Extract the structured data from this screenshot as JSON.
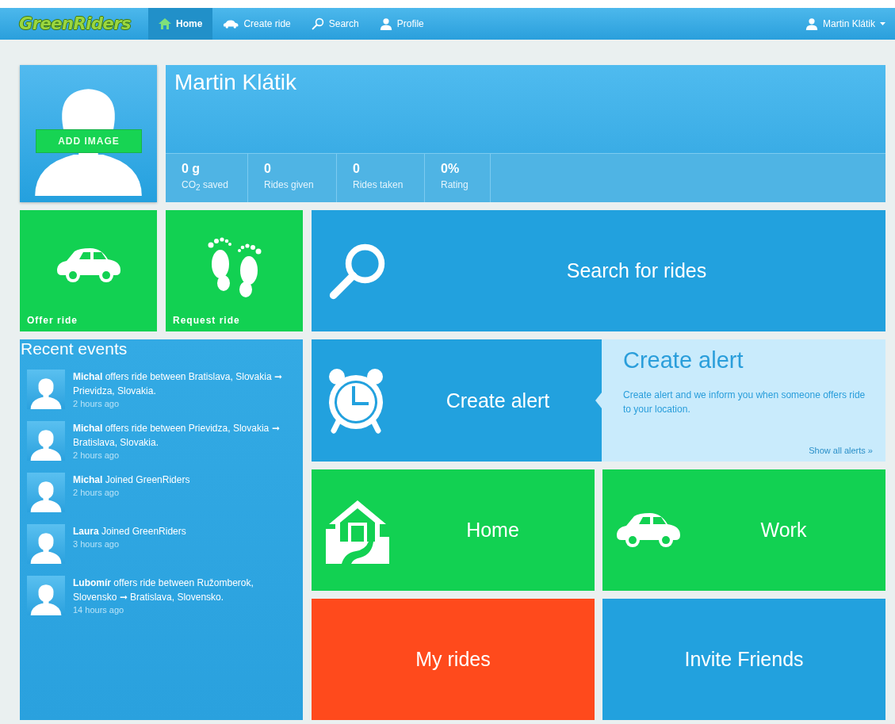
{
  "navbar": {
    "logo": "GreenRiders",
    "items": [
      {
        "label": "Home",
        "selected": true
      },
      {
        "label": "Create ride",
        "selected": false
      },
      {
        "label": "Search",
        "selected": false
      },
      {
        "label": "Profile",
        "selected": false
      }
    ],
    "user": "Martin Klátik"
  },
  "profile": {
    "add_image": "ADD IMAGE",
    "name": "Martin Klátik",
    "stats": [
      {
        "value": "0 g",
        "label": "CO$_{2}$ saved"
      },
      {
        "value": "0",
        "label": "Rides given"
      },
      {
        "value": "0",
        "label": "Rides taken"
      },
      {
        "value": "0%",
        "label": "Rating"
      }
    ]
  },
  "top_tiles": [
    {
      "label": "Offer ride",
      "color": "#12d152"
    },
    {
      "label": "Request ride",
      "color": "#12d152"
    },
    {
      "label": "Search for rides",
      "color": "#22a1de"
    }
  ],
  "recent_events": {
    "title": "Recent events",
    "items": [
      {
        "text": "**Michal** offers ride between Bratislava, Slovakia ➞ Prievidza, Slovakia.",
        "time": "2 hours ago"
      },
      {
        "text": "**Michal** offers ride between Prievidza, Slovakia ➞ Bratislava, Slovakia.",
        "time": "2 hours ago"
      },
      {
        "text": "**Michal** Joined GreenRiders",
        "time": "2 hours ago"
      },
      {
        "text": "**Laura** Joined GreenRiders",
        "time": "3 hours ago"
      },
      {
        "text": "**Lubomír** offers ride between Ružomberok, Slovensko ➞ Bratislava, Slovensko.",
        "time": "14 hours ago"
      }
    ]
  },
  "alert": {
    "tile_label": "Create alert",
    "title": "Create alert",
    "description": "Create alert and we inform you when someone offers ride to your location.",
    "link": "Show all alerts »"
  },
  "bottom_tiles": [
    {
      "label": "Home",
      "color": "#12d152"
    },
    {
      "label": "Work",
      "color": "#12d152"
    },
    {
      "label": "My rides",
      "color": "#ff4a1c"
    },
    {
      "label": "Invite Friends",
      "color": "#22a1de"
    }
  ]
}
